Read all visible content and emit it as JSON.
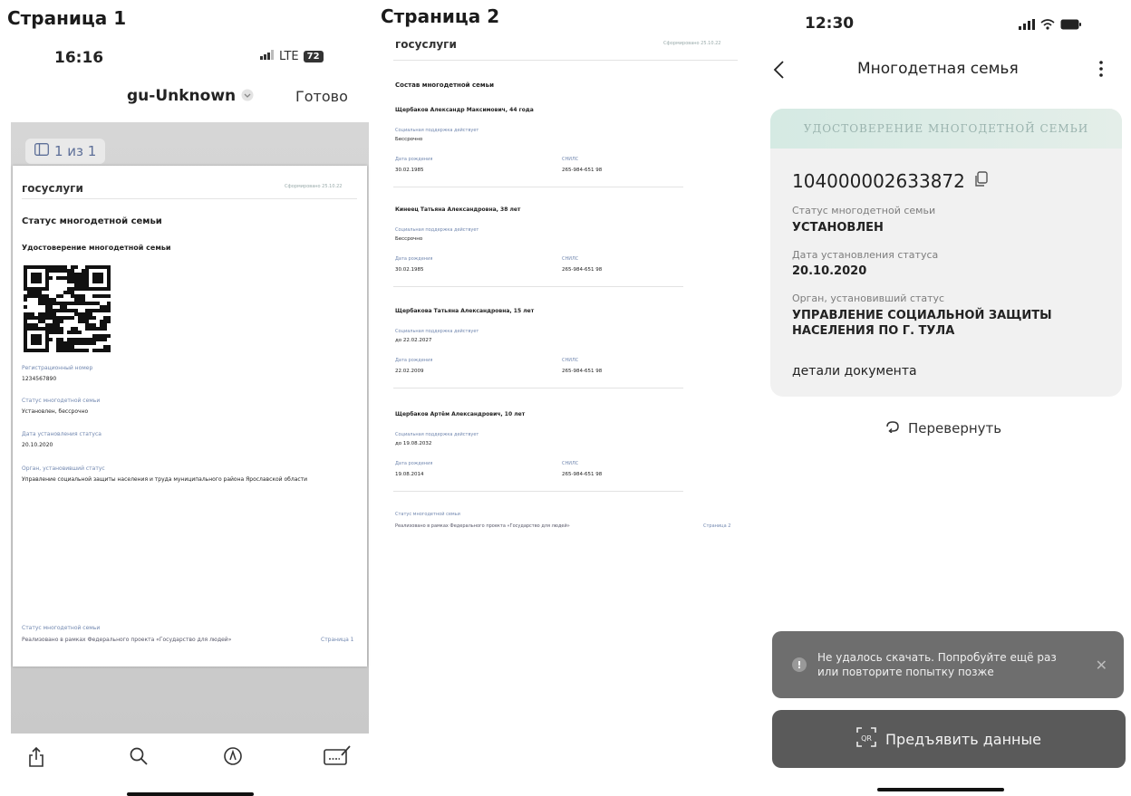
{
  "labels": {
    "page1": "Страница 1",
    "page2": "Страница 2"
  },
  "panel1": {
    "status_time": "16:16",
    "status_network": "LTE",
    "status_battery": "72",
    "title": "gu-Unknown",
    "done": "Готово",
    "page_counter": "1 из 1",
    "doc": {
      "logo": "госуслуги",
      "header_right": "Сформировано 25.10.22",
      "heading": "Статус многодетной семьи",
      "subheading": "Удостоверение многодетной семьи",
      "reg_label": "Регистрационный номер",
      "reg_value": "1234567890",
      "status_label": "Статус многодетной семьи",
      "status_value": "Установлен, бессрочно",
      "date_label": "Дата установления статуса",
      "date_value": "20.10.2020",
      "org_label": "Орган, установивший статус",
      "org_value": "Управление социальной защиты населения и труда муниципального района Ярославской области",
      "footer_label": "Статус многодетной семьи",
      "footer_text": "Реализовано в рамках Федерального проекта «Государство для людей»",
      "footer_page": "Страница 1"
    },
    "toolbar": {
      "share_icon": "share-icon",
      "search_icon": "search-icon",
      "markup_icon": "markup-icon",
      "sign_icon": "signature-icon"
    }
  },
  "panel2": {
    "logo": "госуслуги",
    "header_right": "Сформировано 25.10.22",
    "heading": "Состав многодетной семьи",
    "members": [
      {
        "name": "Щербаков Александр Максимович, 44 года",
        "support_label": "Социальная поддержка действует",
        "support_value": "Бессрочно",
        "dob_label": "Дата рождения",
        "dob": "30.02.1985",
        "snils_label": "СНИЛС",
        "snils": "265-984-651 98"
      },
      {
        "name": "Кинеец Татьяна Александровна, 38 лет",
        "support_label": "Социальная поддержка действует",
        "support_value": "Бессрочно",
        "dob_label": "Дата рождения",
        "dob": "30.02.1985",
        "snils_label": "СНИЛС",
        "snils": "265-984-651 98"
      },
      {
        "name": "Щербакова Татьяна Александровна, 15 лет",
        "support_label": "Социальная поддержка действует",
        "support_value": "до 22.02.2027",
        "dob_label": "Дата рождения",
        "dob": "22.02.2009",
        "snils_label": "СНИЛС",
        "snils": "265-984-651 98"
      },
      {
        "name": "Щербаков Артём Александрович, 10 лет",
        "support_label": "Социальная поддержка действует",
        "support_value": "до 19.08.2032",
        "dob_label": "Дата рождения",
        "dob": "19.08.2014",
        "snils_label": "СНИЛС",
        "snils": "265-984-651 98"
      }
    ],
    "footer_label": "Статус многодетной семьи",
    "footer_text": "Реализовано в рамках Федерального проекта «Государство для людей»",
    "footer_page": "Страница 2"
  },
  "panel3": {
    "status_time": "12:30",
    "nav_title": "Многодетная семья",
    "banner": "УДОСТОВЕРЕНИЕ МНОГОДЕТНОЙ СЕМЬИ",
    "number": "104000002633872",
    "status_label": "Статус многодетной семьи",
    "status_value": "УСТАНОВЛЕН",
    "date_label": "Дата установления статуса",
    "date_value": "20.10.2020",
    "org_label": "Орган, установивший статус",
    "org_value_line1": "УПРАВЛЕНИЕ СОЦИАЛЬНОЙ ЗАЩИТЫ",
    "org_value_line2": "НАСЕЛЕНИЯ ПО Г. ТУЛА",
    "details": "детали документа",
    "flip": "Перевернуть",
    "toast_line1": "Не удалось скачать. Попробуйте ещё раз",
    "toast_line2": "или повторите попытку позже",
    "present": "Предъявить данные"
  }
}
